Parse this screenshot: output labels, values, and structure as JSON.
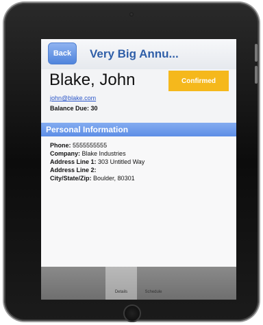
{
  "header": {
    "back_label": "Back",
    "title": "Very Big Annu..."
  },
  "contact": {
    "name": "Blake, John",
    "status": "Confirmed",
    "email": "john@blake.com",
    "balance_label": "Balance Due:",
    "balance_value": "30"
  },
  "section": {
    "title": "Personal Information"
  },
  "personal_info": {
    "phone_label": "Phone:",
    "phone_value": "5555555555",
    "company_label": "Company:",
    "company_value": "Blake Industries",
    "address1_label": "Address Line 1:",
    "address1_value": "303 Untitled Way",
    "address2_label": "Address Line 2:",
    "address2_value": "",
    "cityzip_label": "City/State/Zip:",
    "cityzip_value": "Boulder, 80301"
  },
  "tabs": [
    {
      "label": "Details"
    },
    {
      "label": "Schedule"
    }
  ],
  "colors": {
    "accent_blue": "#5d8ee6",
    "title_blue": "#2f5ea8",
    "status_yellow": "#f5b81c"
  }
}
